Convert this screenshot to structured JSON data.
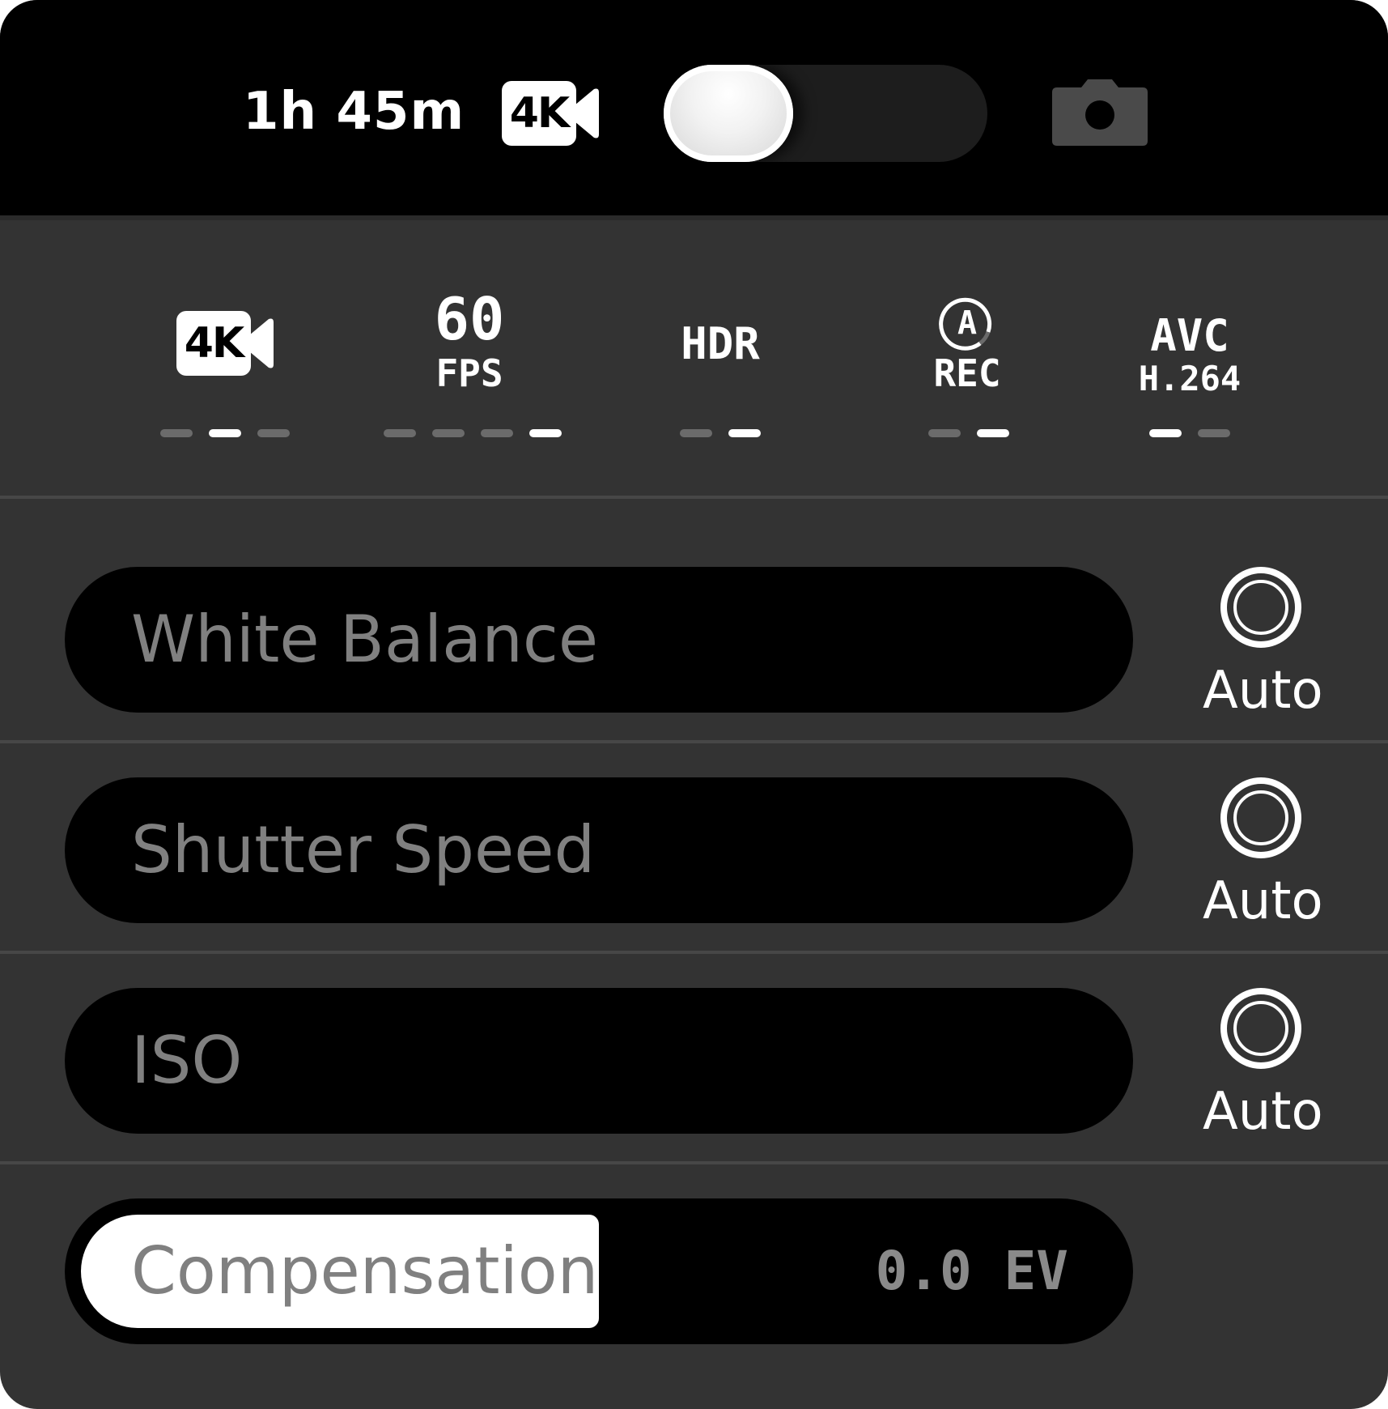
{
  "header": {
    "time_remaining": "1h 45m",
    "video_mode_badge": "4K",
    "mode_toggle": "video",
    "photo_icon": "camera-icon"
  },
  "settings": {
    "resolution": {
      "badge": "4K",
      "icon": "video-camera-icon",
      "options": 3,
      "selected": 2
    },
    "fps": {
      "value": "60",
      "unit": "FPS",
      "options": 4,
      "selected": 4
    },
    "hdr": {
      "label": "HDR",
      "options": 2,
      "selected": 2
    },
    "rec": {
      "badge": "A",
      "label": "REC",
      "options": 2,
      "selected": 2
    },
    "codec": {
      "label": "AVC",
      "sublabel": "H.264",
      "options": 2,
      "selected": 1
    }
  },
  "controls": {
    "white_balance": {
      "label": "White Balance",
      "auto_label": "Auto"
    },
    "shutter_speed": {
      "label": "Shutter Speed",
      "auto_label": "Auto"
    },
    "iso": {
      "label": "ISO",
      "auto_label": "Auto"
    },
    "compensation": {
      "label": "Compensation",
      "value": "0.0 EV",
      "level": 0.5
    }
  },
  "colors": {
    "panel": "#333333",
    "header": "#000000",
    "track": "#000000",
    "label_gray": "#808080",
    "accent": "#ffffff"
  }
}
